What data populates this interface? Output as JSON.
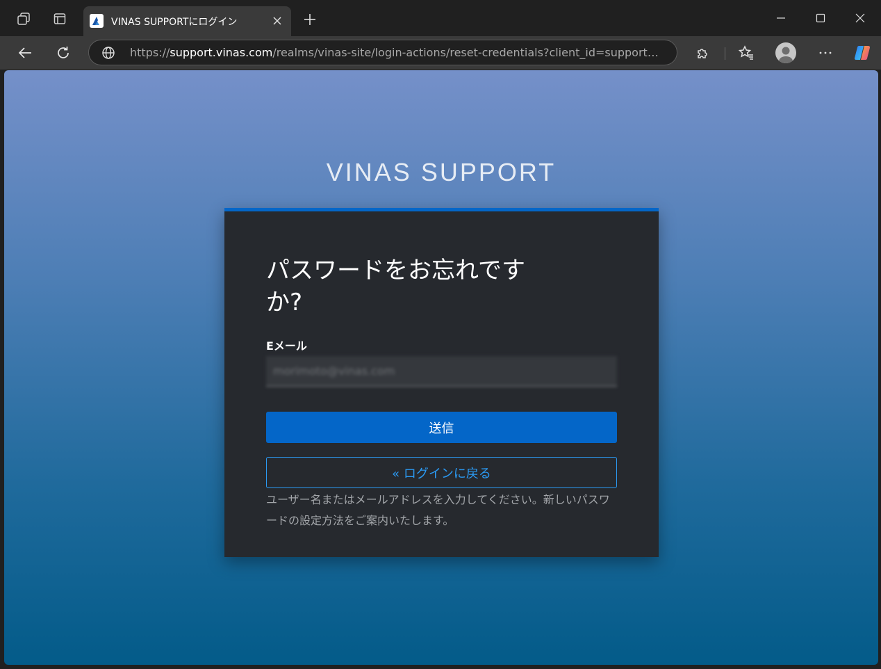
{
  "browser": {
    "tab": {
      "title": "VINAS SUPPORTにログイン",
      "favicon": "vinas-logo-icon"
    },
    "address": {
      "scheme": "https://",
      "host": "support.vinas.com",
      "path": "/realms/vinas-site/login-actions/reset-credentials?client_id=support&ta..."
    },
    "icons": {
      "workspaces": "workspaces-icon",
      "tab_actions": "tab-actions-icon",
      "close_tab": "close-icon",
      "new_tab": "plus-icon",
      "minimize": "minimize-icon",
      "maximize": "maximize-icon",
      "close_window": "close-icon",
      "back": "back-arrow-icon",
      "refresh": "refresh-icon",
      "site_info": "globe-icon",
      "extensions": "puzzle-icon",
      "favorites": "favorites-icon",
      "profile": "profile-icon",
      "more": "more-icon",
      "copilot": "copilot-icon"
    }
  },
  "page": {
    "brand": "VINAS SUPPORT",
    "title": "パスワードをお忘れですか?",
    "email_label": "Eメール",
    "email_value": "morimoto@vinas.com",
    "submit_label": "送信",
    "back_label": "« ログインに戻る",
    "help_text": "ユーザー名またはメールアドレスを入力してください。新しいパスワードの設定方法をご案内いたします。"
  },
  "colors": {
    "accent": "#0466c8",
    "link": "#2b9af3",
    "card_bg": "#26292e"
  }
}
